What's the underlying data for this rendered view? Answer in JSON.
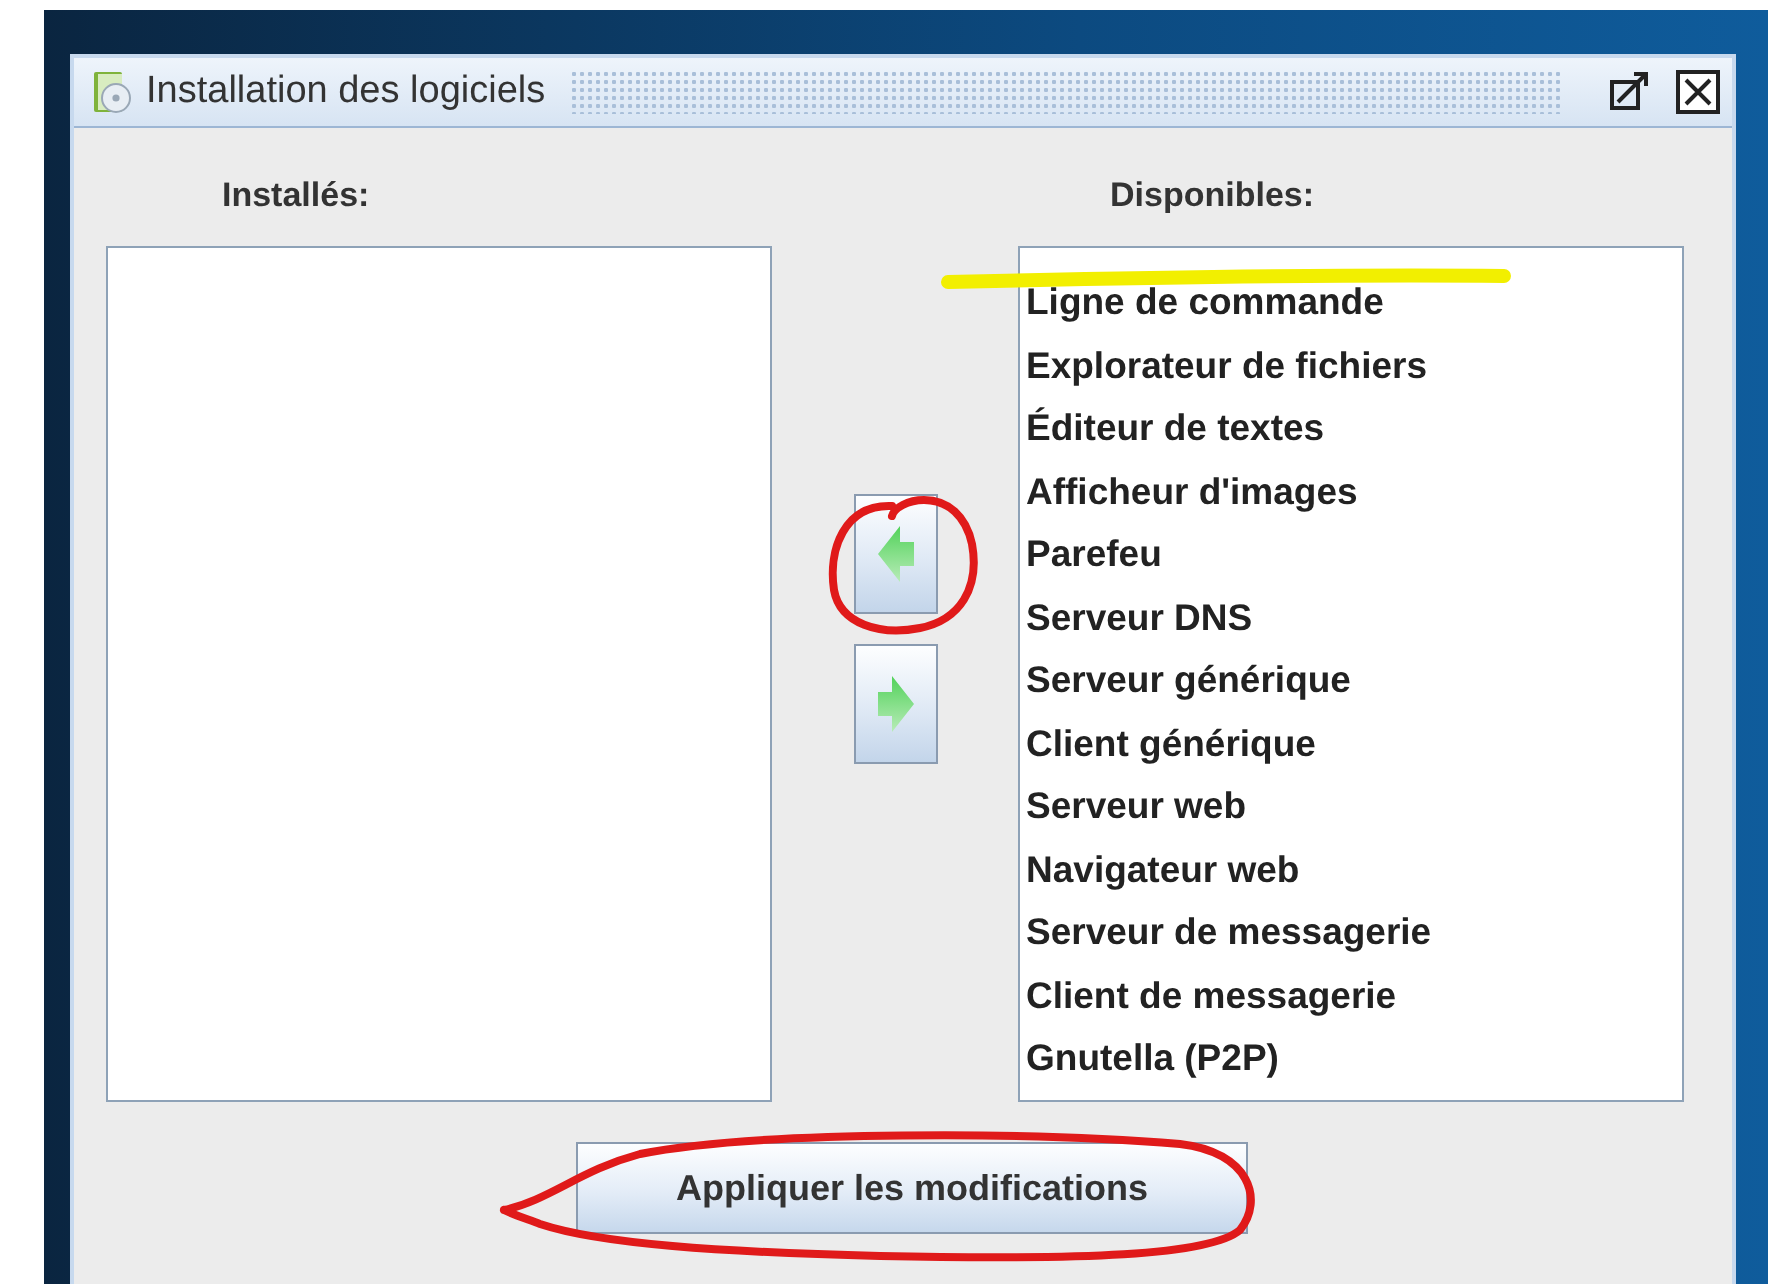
{
  "window": {
    "title": "Installation des logiciels"
  },
  "installed": {
    "label": "Installés:"
  },
  "available": {
    "label": "Disponibles:",
    "items": [
      {
        "text": "Ligne de commande",
        "selected": false
      },
      {
        "text": "Explorateur de fichiers",
        "selected": false
      },
      {
        "text": "Éditeur de textes",
        "selected": false
      },
      {
        "text": "Afficheur d'images",
        "selected": false
      },
      {
        "text": "Parefeu",
        "selected": false
      },
      {
        "text": "Serveur DNS",
        "selected": false
      },
      {
        "text": "Serveur générique",
        "selected": false
      },
      {
        "text": "Client générique",
        "selected": false
      },
      {
        "text": "Serveur web",
        "selected": false
      },
      {
        "text": "Navigateur web",
        "selected": false
      },
      {
        "text": "Serveur de messagerie",
        "selected": false
      },
      {
        "text": "Client de messagerie",
        "selected": false
      },
      {
        "text": "Gnutella (P2P)",
        "selected": false
      }
    ]
  },
  "apply_button": {
    "label": "Appliquer les modifications"
  },
  "annotations": [
    {
      "kind": "highlight",
      "color": "#f2ef00"
    },
    {
      "kind": "loop",
      "color": "#e01a1a"
    },
    {
      "kind": "loop",
      "color": "#e01a1a"
    }
  ]
}
